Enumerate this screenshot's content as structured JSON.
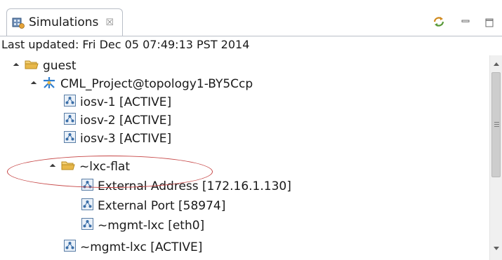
{
  "tab": {
    "title": "Simulations",
    "close_symbol": "☒",
    "icon": "simulations-icon"
  },
  "toolbar": {
    "actions": [
      "refresh-icon",
      "minimize-icon",
      "maximize-icon"
    ]
  },
  "status": {
    "text": "Last updated: Fri Dec 05 07:49:13 PST 2014"
  },
  "tree": {
    "root": {
      "label": "guest",
      "expanded": true,
      "icon": "folder-icon"
    },
    "project": {
      "label": "CML_Project@topology1-BY5Ccp",
      "expanded": true,
      "icon": "topology-icon"
    },
    "nodes": [
      {
        "label": "iosv-1  [ACTIVE]",
        "icon": "node-icon"
      },
      {
        "label": "iosv-2  [ACTIVE]",
        "icon": "node-icon"
      },
      {
        "label": "iosv-3  [ACTIVE]",
        "icon": "node-icon"
      }
    ],
    "lxc_folder": {
      "label": "~lxc-flat",
      "expanded": true,
      "icon": "folder-icon"
    },
    "lxc_children": [
      {
        "label": "External Address  [172.16.1.130]",
        "icon": "node-icon"
      },
      {
        "label": "External Port  [58974]",
        "icon": "node-icon"
      },
      {
        "label": "~mgmt-lxc  [eth0]",
        "icon": "node-icon"
      }
    ],
    "last_node": {
      "label": "~mgmt-lxc  [ACTIVE]",
      "icon": "node-icon"
    }
  },
  "colors": {
    "annotation": "#c64545",
    "folder": "#e8b84a",
    "topology": "#2f7fd0"
  }
}
